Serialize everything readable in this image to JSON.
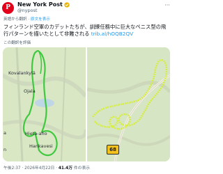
{
  "post": {
    "display_name": "New York Post",
    "handle": "@nypost",
    "translated_from": "英語から翻訳",
    "show_original": "原文を表示",
    "body": "フィンランド空軍のカデットたちが、訓練任務中に巨大なペニス型の飛行パターンを描いたとして非難される",
    "link_text": "trib.al/hOQB2QV",
    "rate_translation": "この翻訳を評価",
    "timestamp": "午後2:37 · 2026年4月22日",
    "views_count": "41.4万",
    "views_label": "件の表示"
  },
  "media": {
    "left_map_labels": {
      "kovalankyla": "Kovalankylä",
      "ojala": "Ojala",
      "hieta_aho": "Hieta-aho",
      "hankavesi": "Hankavesi",
      "left_edge": "a",
      "left_edge_bottom": "n"
    },
    "road_label": "68",
    "colors": {
      "map_background": "#d8e6c6",
      "track_left": "#3ec93e",
      "track_right": "#d6ef3a",
      "road_badge": "#f4c21a",
      "brand": "#e2001a",
      "link": "#1d9bf0"
    }
  }
}
